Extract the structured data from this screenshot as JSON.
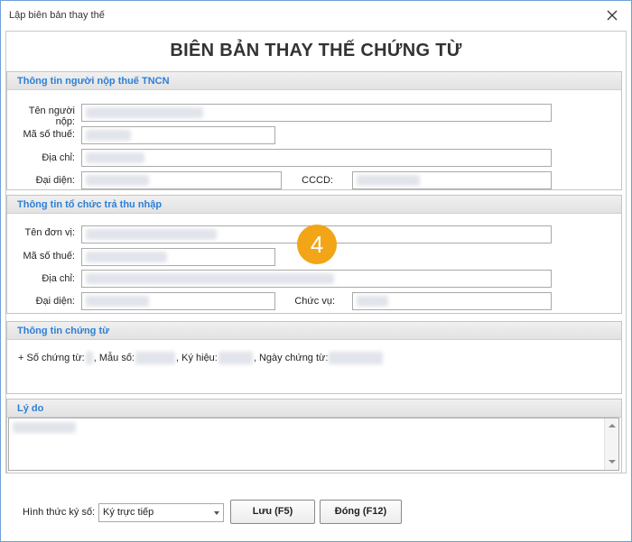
{
  "window": {
    "title": "Lập biên bản thay thế"
  },
  "heading": "BIÊN BẢN THAY THẾ CHỨNG TỪ",
  "taxpayer": {
    "header": "Thông tin người nộp thuế TNCN",
    "name_label": "Tên người nộp:",
    "tax_code_label": "Mã số thuế:",
    "address_label": "Địa chỉ:",
    "rep_label": "Đại diện:",
    "id_label": "CCCD:"
  },
  "payer_org": {
    "header": "Thông tin tổ chức trả thu nhập",
    "name_label": "Tên đơn vị:",
    "tax_code_label": "Mã số thuế:",
    "address_label": "Địa chỉ:",
    "rep_label": "Đại diện:",
    "position_label": "Chức vụ:"
  },
  "certificate": {
    "header": "Thông tin chứng từ",
    "number_label": "+ Số chứng từ:",
    "form_label": ", Mẫu số:",
    "symbol_label": ", Ký hiệu:",
    "date_label": ", Ngày chứng từ:"
  },
  "reason": {
    "header": "Lý do"
  },
  "step_badge": "4",
  "footer": {
    "sign_method_label": "Hình thức ký số:",
    "sign_method_value": "Ký trực tiếp",
    "save_button": "Lưu (F5)",
    "close_button": "Đóng (F12)"
  }
}
